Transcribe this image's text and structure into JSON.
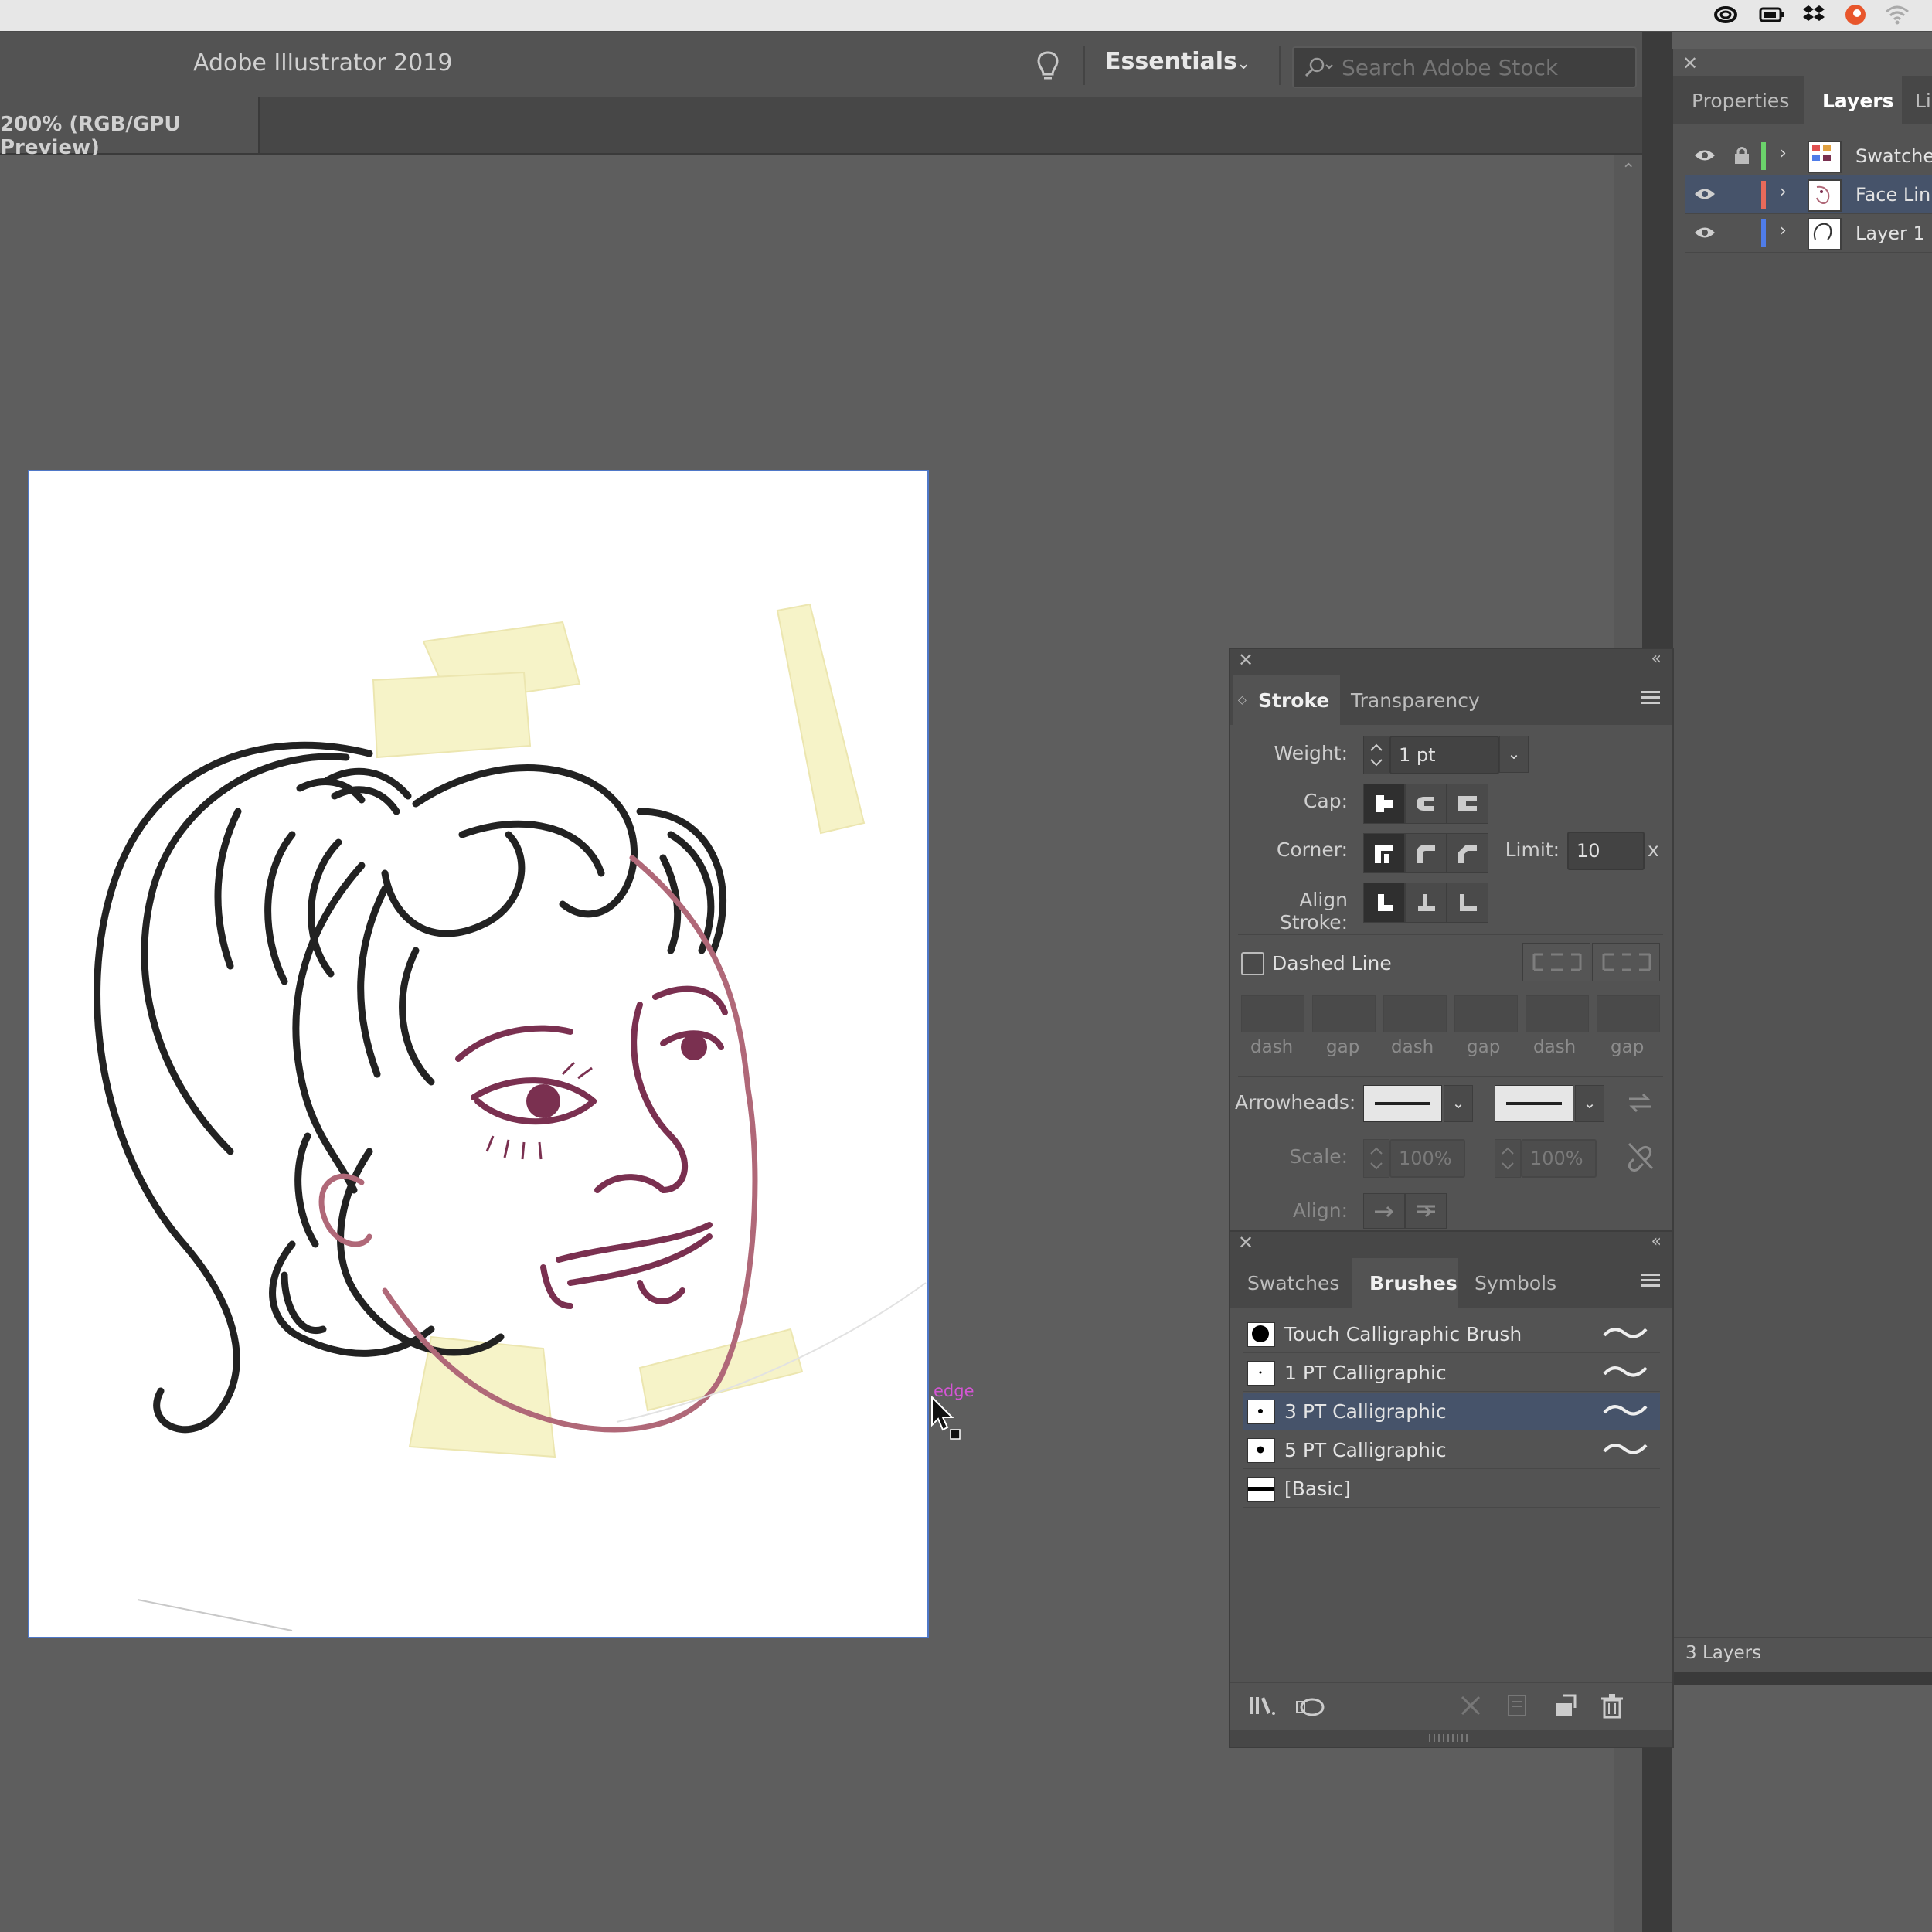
{
  "app": {
    "title": "Adobe Illustrator 2019",
    "workspace": "Essentials",
    "search_placeholder": "Search Adobe Stock"
  },
  "document": {
    "tab_label": "200% (RGB/GPU Preview)"
  },
  "cursor": {
    "hint_label": "edge"
  },
  "layers_panel": {
    "tabs": [
      "Properties",
      "Layers",
      "Li"
    ],
    "active_tab": "Layers",
    "layers": [
      {
        "name": "Swatche",
        "color": "#6bd36b",
        "locked": true,
        "selected": false
      },
      {
        "name": "Face Lin",
        "color": "#e86a5a",
        "locked": false,
        "selected": true
      },
      {
        "name": "Layer 1",
        "color": "#4f7ce8",
        "locked": false,
        "selected": false
      }
    ],
    "count_label": "3 Layers"
  },
  "stroke_panel": {
    "tabs": [
      "Stroke",
      "Transparency"
    ],
    "active_tab": "Stroke",
    "weight_label": "Weight:",
    "weight_value": "1 pt",
    "cap_label": "Cap:",
    "corner_label": "Corner:",
    "limit_label": "Limit:",
    "limit_value": "10",
    "limit_unit": "x",
    "align_stroke_label": "Align Stroke:",
    "dashed_line_label": "Dashed Line",
    "dashed_checked": false,
    "dash_labels": [
      "dash",
      "gap",
      "dash",
      "gap",
      "dash",
      "gap"
    ],
    "arrowheads_label": "Arrowheads:",
    "scale_label": "Scale:",
    "scale_start": "100%",
    "scale_end": "100%",
    "align_label": "Align:"
  },
  "brushes_panel": {
    "tabs": [
      "Swatches",
      "Brushes",
      "Symbols"
    ],
    "active_tab": "Brushes",
    "brushes": [
      {
        "name": "Touch Calligraphic Brush",
        "selected": false
      },
      {
        "name": "1 PT Calligraphic",
        "selected": false
      },
      {
        "name": "3 PT Calligraphic",
        "selected": true
      },
      {
        "name": "5 PT Calligraphic",
        "selected": false
      },
      {
        "name": "[Basic]",
        "selected": false
      }
    ]
  },
  "colors": {
    "selection_blue": "#46536a",
    "artboard_border": "#4f78c8",
    "face_line": "#b06878",
    "feature_line": "#7a3050",
    "tape": "#f6f3c8"
  }
}
